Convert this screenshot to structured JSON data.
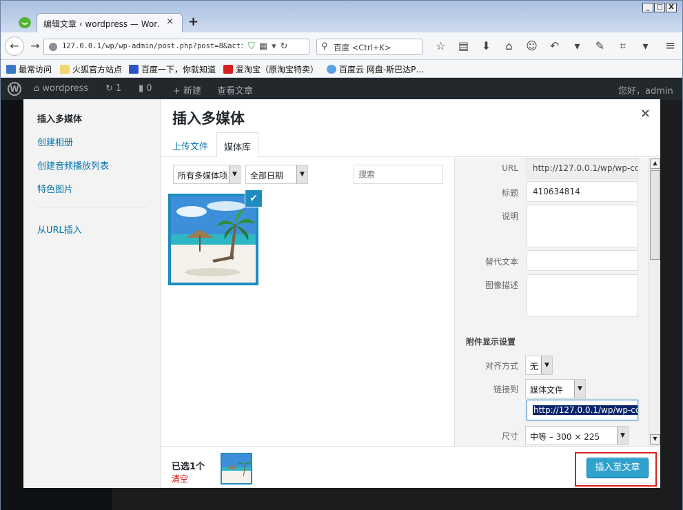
{
  "browser": {
    "tab_title": "编辑文章 ‹ wordpress — Wor…",
    "tab_close": "×",
    "new_tab": "+",
    "url": "127.0.0.1/wp/wp-admin/post.php?post=8&action",
    "search_placeholder": "百度 <Ctrl+K>",
    "window_buttons": [
      "_",
      "□",
      "X"
    ],
    "bookmarks": [
      "最常访问",
      "火狐官方站点",
      "百度一下，你就知道",
      "爱淘宝（原淘宝特卖）",
      "百度云 网盘-斯巴达P…"
    ]
  },
  "wp_admin_bar": {
    "site_name": "wordpress",
    "updates": "1",
    "comments": "0",
    "new": "新建",
    "view_post": "查看文章",
    "greeting": "您好，admin"
  },
  "modal": {
    "title": "插入多媒体",
    "close": "×",
    "menu": [
      "插入多媒体",
      "创建相册",
      "创建音频播放列表",
      "特色图片"
    ],
    "menu_url": "从URL插入",
    "tabs": [
      "上传文件",
      "媒体库"
    ],
    "filters": {
      "type": "所有多媒体项",
      "date": "全部日期",
      "search_placeholder": "搜索"
    },
    "details": {
      "url_label": "URL",
      "url_value": "http://127.0.0.1/wp/wp-co",
      "title_label": "标题",
      "title_value": "410634814",
      "caption_label": "说明",
      "alt_label": "替代文本",
      "desc_label": "图像描述",
      "section_title": "附件显示设置",
      "align_label": "对齐方式",
      "align_value": "无",
      "link_label": "链接到",
      "link_value": "媒体文件",
      "link_url": "http://127.0.0.1/wp/wp-co",
      "size_label": "尺寸",
      "size_value": "中等 – 300 × 225"
    },
    "toolbar": {
      "selected": "已选1个",
      "clear": "清空",
      "insert": "插入至文章"
    }
  },
  "colors": {
    "accent": "#2ea2cc",
    "highlight_box": "#d8211b",
    "admin_bar": "#23282d"
  }
}
